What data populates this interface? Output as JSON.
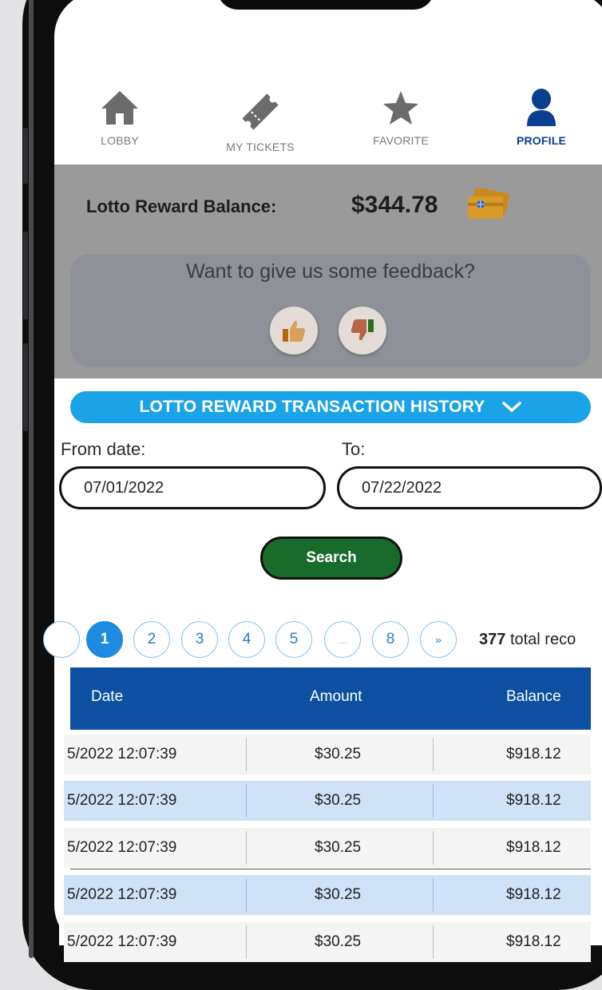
{
  "nav": {
    "items": [
      {
        "label": "LOBBY",
        "icon": "home-icon"
      },
      {
        "label": "MY TICKETS",
        "icon": "ticket-icon"
      },
      {
        "label": "FAVORITE",
        "icon": "star-icon"
      },
      {
        "label": "PROFILE",
        "icon": "user-icon"
      }
    ],
    "active": "PROFILE"
  },
  "balance": {
    "label": "Lotto Reward Balance:",
    "value": "$344.78",
    "icon": "reward-card-icon"
  },
  "feedback": {
    "prompt": "Want to give us some feedback?",
    "icons": [
      "thumbs-up-icon",
      "thumbs-down-icon"
    ]
  },
  "history": {
    "title": "LOTTO REWARD TRANSACTION HISTORY",
    "from_label": "From date:",
    "to_label": "To:",
    "from_value": "07/01/2022",
    "to_value": "07/22/2022",
    "search_label": "Search"
  },
  "pagination": {
    "pages": [
      "1",
      "2",
      "3",
      "4",
      "5",
      "...",
      "8",
      "»"
    ],
    "current": "1",
    "total_count": "377",
    "total_suffix": "total reco"
  },
  "table": {
    "columns": [
      "Date",
      "Amount",
      "Balance"
    ],
    "rows": [
      [
        "5/2022 12:07:39",
        "$30.25",
        "$918.12"
      ],
      [
        "5/2022 12:07:39",
        "$30.25",
        "$918.12"
      ],
      [
        "5/2022 12:07:39",
        "$30.25",
        "$918.12"
      ],
      [
        "5/2022 12:07:39",
        "$30.25",
        "$918.12"
      ],
      [
        "5/2022 12:07:39",
        "$30.25",
        "$918.12"
      ]
    ]
  },
  "colors": {
    "accent_blue": "#1aa3e6",
    "header_navy": "#0d4fa0",
    "search_green": "#196b2b",
    "row_alt": "#cfe2f7",
    "profile_active": "#0a3e8f"
  }
}
